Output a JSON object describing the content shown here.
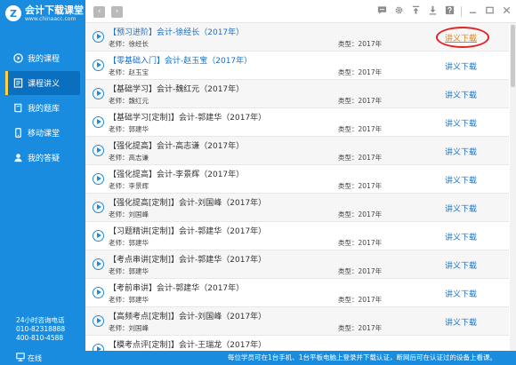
{
  "app": {
    "logo_mark": "Z",
    "name": "会计下载课堂",
    "url": "www.chinaacc.com"
  },
  "sidebar": {
    "items": [
      {
        "label": "我的课程",
        "icon": "play-circle-icon"
      },
      {
        "label": "课程讲义",
        "icon": "notes-icon"
      },
      {
        "label": "我的题库",
        "icon": "book-icon"
      },
      {
        "label": "移动课堂",
        "icon": "phone-icon"
      },
      {
        "label": "我的答疑",
        "icon": "user-icon"
      }
    ],
    "hotline_label": "24小时咨询电话",
    "phone1": "010-82318888",
    "phone2": "400-810-4588",
    "online_label": "在线"
  },
  "toolbar": {
    "back": "‹",
    "forward": "›"
  },
  "courses": [
    {
      "title": "【预习进阶】会计-徐经长（2017年）",
      "teacher": "老师：徐经长",
      "type": "类型：2017年",
      "download": "讲义下载"
    },
    {
      "title": "【零基础入门】会计-赵玉宝（2017年）",
      "teacher": "老师：赵玉宝",
      "type": "类型：2017年",
      "download": "讲义下载"
    },
    {
      "title": "【基础学习】会计-魏红元（2017年）",
      "teacher": "老师：魏红元",
      "type": "类型：2017年",
      "download": "讲义下载"
    },
    {
      "title": "【基础学习[定制]】会计-郭建华（2017年）",
      "teacher": "老师：郭建华",
      "type": "类型：2017年",
      "download": "讲义下载"
    },
    {
      "title": "【强化提高】会计-高志谦（2017年）",
      "teacher": "老师：高志谦",
      "type": "类型：2017年",
      "download": "讲义下载"
    },
    {
      "title": "【强化提高】会计-李景辉（2017年）",
      "teacher": "老师：李景辉",
      "type": "类型：2017年",
      "download": "讲义下载"
    },
    {
      "title": "【强化提高[定制]】会计-刘国峰（2017年）",
      "teacher": "老师：刘国峰",
      "type": "类型：2017年",
      "download": "讲义下载"
    },
    {
      "title": "【习题精讲[定制]】会计-郭建华（2017年）",
      "teacher": "老师：郭建华",
      "type": "类型：2017年",
      "download": "讲义下载"
    },
    {
      "title": "【考点串讲[定制]】会计-郭建华（2017年）",
      "teacher": "老师：郭建华",
      "type": "类型：2017年",
      "download": "讲义下载"
    },
    {
      "title": "【考前串讲】会计-郭建华（2017年）",
      "teacher": "老师：郭建华",
      "type": "类型：2017年",
      "download": "讲义下载"
    },
    {
      "title": "【高频考点[定制]】会计-刘国峰（2017年）",
      "teacher": "老师：刘国峰",
      "type": "类型：2017年",
      "download": "讲义下载"
    },
    {
      "title": "【模考点评[定制]】会计-王瑞龙（2017年）",
      "teacher": "",
      "type": "",
      "download": ""
    }
  ],
  "footer": {
    "notice": "每位学员可在1台手机、1台平板电脑上登录并下载认证，断网后可在认证过的设备上看课。"
  },
  "colors": {
    "accent": "#1a8ce0",
    "active_nav": "#0b6fc0",
    "link": "#1a6fc2",
    "circled_link": "#d9821f",
    "annotation_ring": "#e02424"
  }
}
